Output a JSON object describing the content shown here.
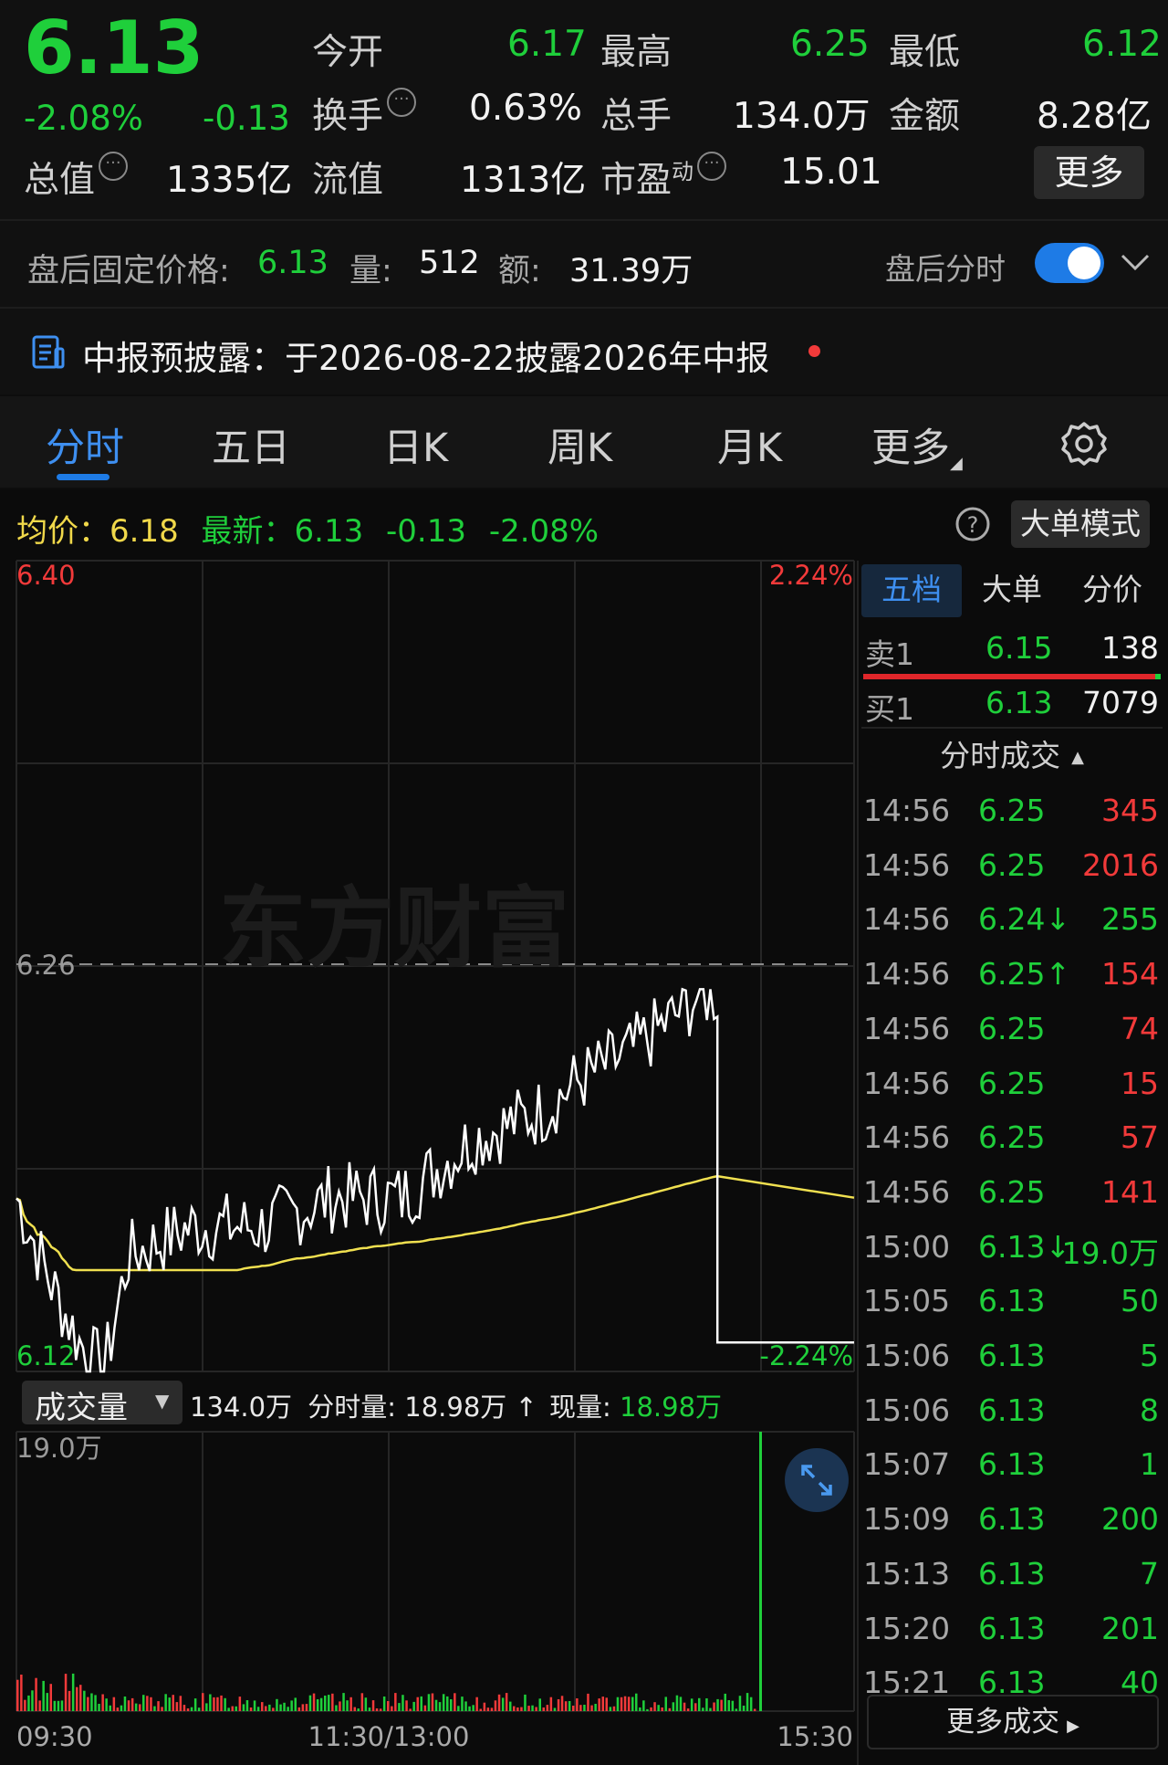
{
  "quote": {
    "price": "6.13",
    "change_pct": "-2.08%",
    "change": "-0.13",
    "stats": [
      {
        "label": "今开",
        "value": "6.17"
      },
      {
        "label": "最高",
        "value": "6.25"
      },
      {
        "label": "最低",
        "value": "6.12"
      },
      {
        "label": "换手",
        "value": "0.63%"
      },
      {
        "label": "总手",
        "value": "134.0万"
      },
      {
        "label": "金额",
        "value": "8.28亿"
      },
      {
        "label": "总值",
        "value": "1335亿"
      },
      {
        "label": "流值",
        "value": "1313亿"
      },
      {
        "label": "市盈",
        "sup": "动",
        "value": "15.01"
      }
    ],
    "more_label": "更多"
  },
  "after_hours": {
    "price_label": "盘后固定价格:",
    "price": "6.13",
    "vol_label": "量:",
    "vol": "512",
    "amount_label": "额:",
    "amount": "31.39万",
    "toggle_label": "盘后分时",
    "toggle_on": true
  },
  "notice": {
    "text": "中报预披露：于2026-08-22披露2026年中报"
  },
  "tabs": [
    {
      "label": "分时",
      "active": true
    },
    {
      "label": "五日"
    },
    {
      "label": "日K"
    },
    {
      "label": "周K"
    },
    {
      "label": "月K"
    },
    {
      "label": "更多"
    }
  ],
  "legend": {
    "avg_label": "均价：",
    "avg": "6.18",
    "latest_label": "最新：",
    "latest": "6.13",
    "latest_change": "-0.13",
    "latest_pct": "-2.08%",
    "big_order_mode": "大单模式"
  },
  "chart_data": {
    "type": "line",
    "y_left_ticks": [
      "6.40",
      "6.26",
      "6.12"
    ],
    "y_right_ticks": [
      "2.24%",
      "-2.24%"
    ],
    "x_ticks": [
      "09:30",
      "11:30/13:00",
      "15:30"
    ],
    "prev_close": 6.26,
    "ylim": [
      6.12,
      6.4
    ],
    "colors": {
      "price": "#ffffff",
      "avg": "#f0e050",
      "up": "#f23a3a",
      "down": "#1fcf3b"
    }
  },
  "volume": {
    "selector_label": "成交量",
    "total": "134.0万",
    "minute_label": "分时量:",
    "minute_value": "18.98万",
    "now_label": "现量:",
    "now_value": "18.98万",
    "y_max": "19.0万"
  },
  "right_panel": {
    "tabs": [
      "五档",
      "大单",
      "分价"
    ],
    "sell1": {
      "label": "卖1",
      "price": "6.15",
      "vol": "138"
    },
    "buy1": {
      "label": "买1",
      "price": "6.13",
      "vol": "7079"
    },
    "trades_title": "分时成交",
    "trades": [
      {
        "time": "14:56",
        "price": "6.25",
        "vol": "345",
        "vc": "red"
      },
      {
        "time": "14:56",
        "price": "6.25",
        "vol": "2016",
        "vc": "red"
      },
      {
        "time": "14:56",
        "price": "6.24↓",
        "vol": "255",
        "vc": "green"
      },
      {
        "time": "14:56",
        "price": "6.25↑",
        "vol": "154",
        "vc": "red"
      },
      {
        "time": "14:56",
        "price": "6.25",
        "vol": "74",
        "vc": "red"
      },
      {
        "time": "14:56",
        "price": "6.25",
        "vol": "15",
        "vc": "red"
      },
      {
        "time": "14:56",
        "price": "6.25",
        "vol": "57",
        "vc": "red"
      },
      {
        "time": "14:56",
        "price": "6.25",
        "vol": "141",
        "vc": "red"
      },
      {
        "time": "15:00",
        "price": "6.13↓",
        "vol": "19.0万",
        "vc": "green"
      },
      {
        "time": "15:05",
        "price": "6.13",
        "vol": "50",
        "vc": "green"
      },
      {
        "time": "15:06",
        "price": "6.13",
        "vol": "5",
        "vc": "green"
      },
      {
        "time": "15:06",
        "price": "6.13",
        "vol": "8",
        "vc": "green"
      },
      {
        "time": "15:07",
        "price": "6.13",
        "vol": "1",
        "vc": "green"
      },
      {
        "time": "15:09",
        "price": "6.13",
        "vol": "200",
        "vc": "green"
      },
      {
        "time": "15:13",
        "price": "6.13",
        "vol": "7",
        "vc": "green"
      },
      {
        "time": "15:20",
        "price": "6.13",
        "vol": "201",
        "vc": "green"
      },
      {
        "time": "15:21",
        "price": "6.13",
        "vol": "40",
        "vc": "green"
      }
    ],
    "more_trades": "更多成交"
  },
  "watermark": "东方财富"
}
